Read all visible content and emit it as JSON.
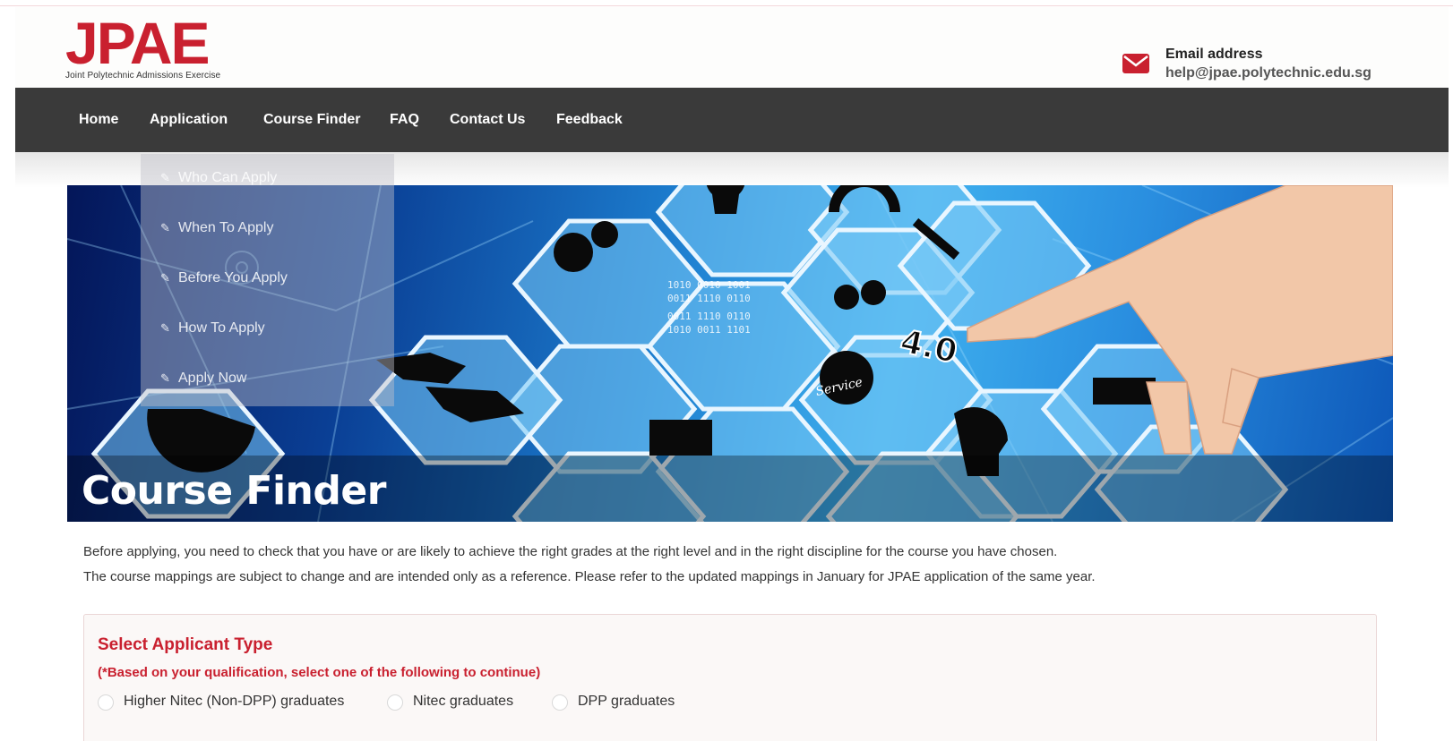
{
  "brand": {
    "logo_text": "JPAE",
    "logo_subtitle": "Joint Polytechnic Admissions Exercise",
    "accent_color": "#c9202f"
  },
  "contact": {
    "icon": "envelope-icon",
    "label": "Email address",
    "value": "help@jpae.polytechnic.edu.sg"
  },
  "nav": {
    "items": [
      {
        "label": "Home"
      },
      {
        "label": "Application"
      },
      {
        "label": "Course Finder"
      },
      {
        "label": "FAQ"
      },
      {
        "label": "Contact Us"
      },
      {
        "label": "Feedback"
      }
    ]
  },
  "dropdown": {
    "icon": "pencil-icon",
    "items": [
      {
        "label": "Who Can Apply"
      },
      {
        "label": "When To Apply"
      },
      {
        "label": "Before You Apply"
      },
      {
        "label": "How To Apply"
      },
      {
        "label": "Apply Now"
      }
    ]
  },
  "hero": {
    "title": "Course Finder",
    "image_labels": {
      "industry": "4.0",
      "service": "Service"
    }
  },
  "intro": {
    "line1": "Before applying, you need to check that you have or are likely to achieve the right grades at the right level and in the right discipline for the course you have chosen.",
    "line2": "The course mappings are subject to change and are intended only as a reference. Please refer to the updated mappings in January for JPAE application of the same year."
  },
  "applicant_type": {
    "title": "Select Applicant Type",
    "note": "(*Based on your qualification, select one of the following to continue)",
    "options": [
      {
        "label": "Higher Nitec (Non-DPP) graduates",
        "selected": false
      },
      {
        "label": "Nitec graduates",
        "selected": false
      },
      {
        "label": "DPP graduates",
        "selected": false
      }
    ]
  }
}
